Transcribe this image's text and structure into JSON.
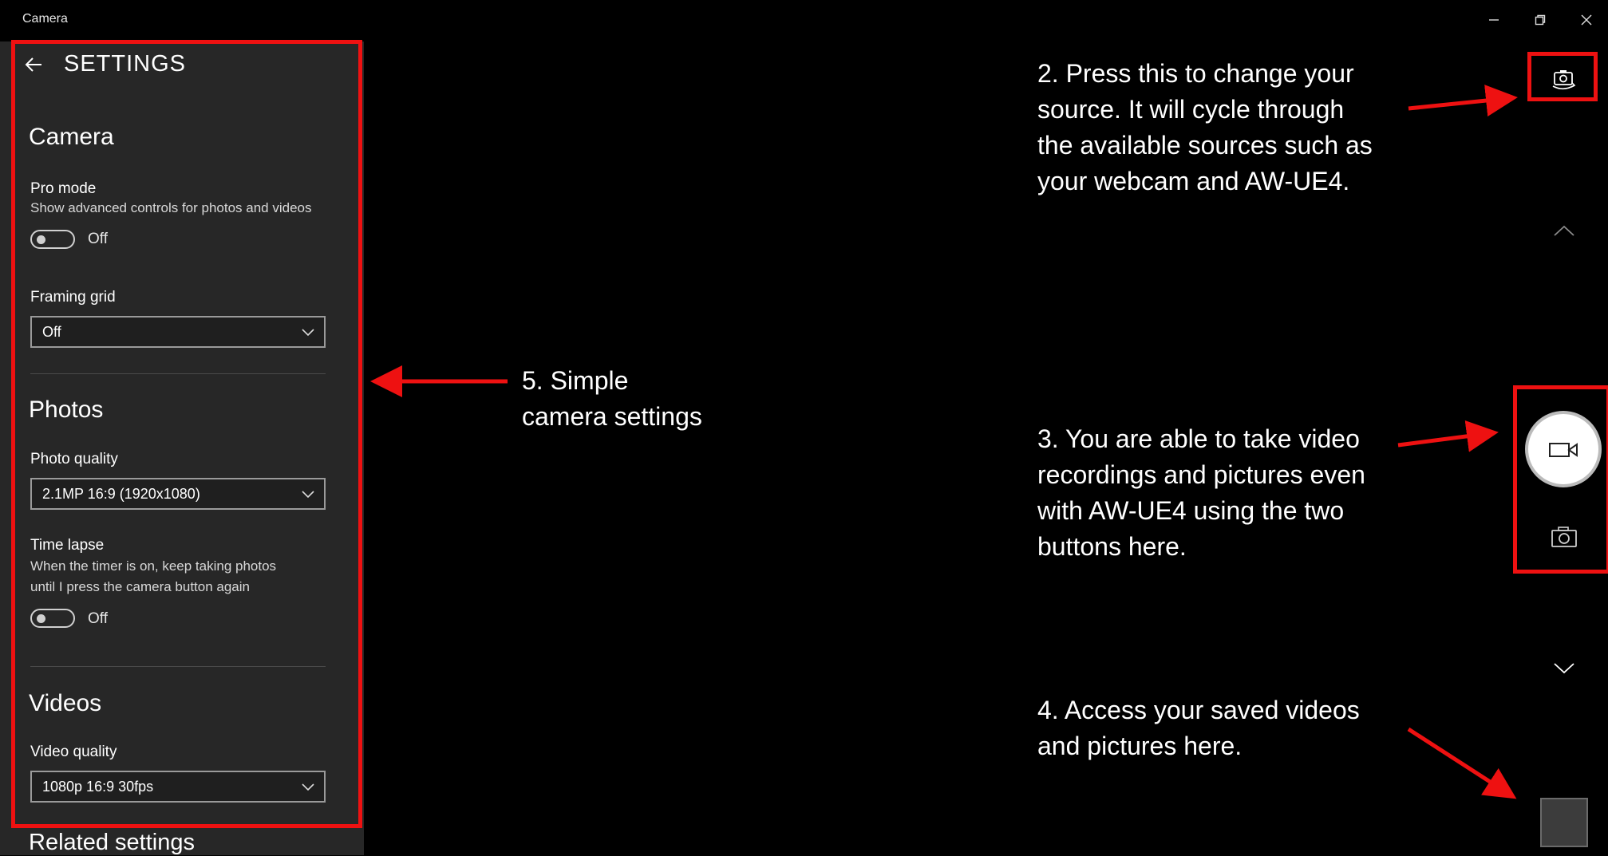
{
  "window": {
    "title": "Camera",
    "minimize_icon": "minimize-icon",
    "restore_icon": "restore-icon",
    "close_icon": "close-icon"
  },
  "settings": {
    "heading": "SETTINGS",
    "camera": {
      "section": "Camera",
      "pro_mode_label": "Pro mode",
      "pro_mode_desc": "Show advanced controls for photos and videos",
      "pro_mode_state": "Off",
      "framing_grid_label": "Framing grid",
      "framing_grid_value": "Off"
    },
    "photos": {
      "section": "Photos",
      "photo_quality_label": "Photo quality",
      "photo_quality_value": "2.1MP 16:9 (1920x1080)",
      "time_lapse_label": "Time lapse",
      "time_lapse_desc_1": "When the timer is on, keep taking photos",
      "time_lapse_desc_2": "until I press the camera button again",
      "time_lapse_state": "Off"
    },
    "videos": {
      "section": "Videos",
      "video_quality_label": "Video quality",
      "video_quality_value": "1080p 16:9 30fps"
    },
    "related": "Related settings"
  },
  "annotations": {
    "note2": [
      "2. Press this to change your",
      "source. It will cycle through",
      "the available sources such as",
      "your webcam and AW-UE4."
    ],
    "note3": [
      "3. You are able to take video",
      "recordings and pictures even",
      "with AW-UE4 using the two",
      "buttons here."
    ],
    "note4": [
      "4. Access your saved videos",
      "and pictures here."
    ],
    "note5": [
      "5. Simple",
      "camera settings"
    ]
  },
  "colors": {
    "highlight": "#ee1111",
    "panel": "#272727",
    "background": "#000000"
  }
}
